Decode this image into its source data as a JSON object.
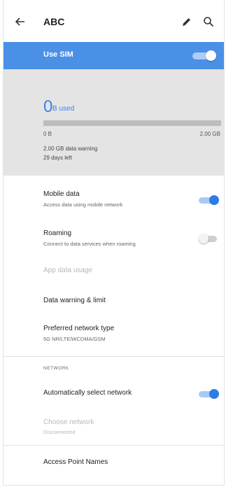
{
  "header": {
    "title": "ABC"
  },
  "use_sim": {
    "label": "Use SIM",
    "enabled": true
  },
  "usage": {
    "amount": "0",
    "unit": "B used",
    "used_fraction": 0,
    "min_label": "0 B",
    "max_label": "2.00 GB",
    "warning": "2.00 GB data warning",
    "days_left": "29 days left"
  },
  "items": {
    "mobile_data": {
      "title": "Mobile data",
      "subtitle": "Access data using mobile network",
      "on": true
    },
    "roaming": {
      "title": "Roaming",
      "subtitle": "Connect to data services when roaming",
      "on": false
    },
    "app_data_usage": {
      "title": "App data usage"
    },
    "data_warning": {
      "title": "Data warning & limit"
    },
    "preferred_network": {
      "title": "Preferred network type",
      "subtitle": "5G NR/LTE/WCDMA/GSM"
    },
    "network_section": "NETWORK",
    "auto_select": {
      "title": "Automatically select network",
      "on": true
    },
    "choose_network": {
      "title": "Choose network",
      "subtitle": "Disconnected"
    },
    "apn": {
      "title": "Access Point Names"
    }
  },
  "colors": {
    "accent": "#3b82e6",
    "sim_bar": "#4a90e6",
    "usage_bg": "#e4e4e4"
  }
}
